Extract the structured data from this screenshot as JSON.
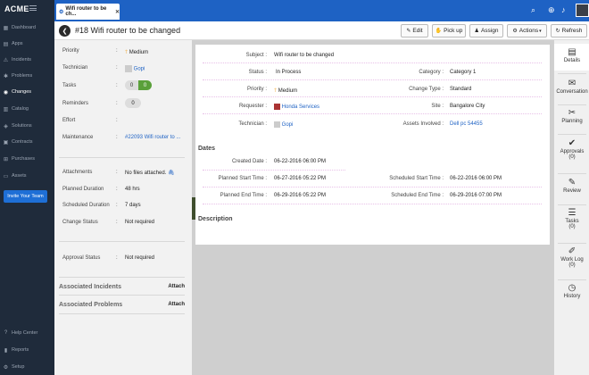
{
  "app": {
    "logo": "ACME"
  },
  "nav": {
    "items": [
      {
        "label": "Dashboard",
        "icon": "dashboard-icon",
        "glyph": "▦"
      },
      {
        "label": "Apps",
        "icon": "apps-icon",
        "glyph": "▤"
      },
      {
        "label": "Incidents",
        "icon": "incidents-icon",
        "glyph": "⚠"
      },
      {
        "label": "Problems",
        "icon": "problems-icon",
        "glyph": "✱"
      },
      {
        "label": "Changes",
        "icon": "changes-icon",
        "glyph": "◉"
      },
      {
        "label": "Catalog",
        "icon": "catalog-icon",
        "glyph": "▥"
      },
      {
        "label": "Solutions",
        "icon": "solutions-icon",
        "glyph": "◈"
      },
      {
        "label": "Contracts",
        "icon": "contracts-icon",
        "glyph": "▣"
      },
      {
        "label": "Purchases",
        "icon": "purchases-icon",
        "glyph": "⊞"
      },
      {
        "label": "Assets",
        "icon": "assets-icon",
        "glyph": "▭"
      }
    ],
    "invite": "Invite Your Team",
    "bottom": [
      {
        "label": "Help Center",
        "icon": "help-icon",
        "glyph": "?"
      },
      {
        "label": "Reports",
        "icon": "reports-icon",
        "glyph": "▮"
      },
      {
        "label": "Setup",
        "icon": "setup-icon",
        "glyph": "⚙"
      }
    ]
  },
  "tab": {
    "label": "Wifi router to be ch..."
  },
  "title": "#18 Wifi router to be changed",
  "toolbar": {
    "edit": "Edit",
    "pickup": "Pick up",
    "assign": "Assign",
    "actions": "Actions",
    "refresh": "Refresh"
  },
  "left_panel": {
    "priority_label": "Priority",
    "priority_value": "Medium",
    "technician_label": "Technician",
    "technician_value": "Gopi",
    "tasks_label": "Tasks",
    "tasks_a": "0",
    "tasks_b": "0",
    "reminders_label": "Reminders",
    "reminders_value": "0",
    "effort_label": "Effort",
    "maintenance_label": "Maintenance",
    "maintenance_value": "#22093 Wifi router to ...",
    "attachments_label": "Attachments",
    "attachments_value": "No files attached.",
    "planned_duration_label": "Planned Duration",
    "planned_duration_value": "48 hrs",
    "scheduled_duration_label": "Scheduled Duration",
    "scheduled_duration_value": "7 days",
    "change_status_label": "Change Status",
    "change_status_value": "Not required",
    "approval_status_label": "Approval Status",
    "approval_status_value": "Not required",
    "assoc_incidents": "Associated Incidents",
    "assoc_problems": "Associated Problems",
    "attach": "Attach"
  },
  "details": {
    "subject_label": "Subject :",
    "subject_value": "Wifi router to be changed",
    "status_label": "Status :",
    "status_value": "In Process",
    "category_label": "Category :",
    "category_value": "Category 1",
    "priority_label": "Priority :",
    "priority_value": "Medium",
    "change_type_label": "Change Type :",
    "change_type_value": "Standard",
    "requester_label": "Requester :",
    "requester_value": "Honda Services",
    "site_label": "Site :",
    "site_value": "Bangalore City",
    "technician_label": "Technician :",
    "technician_value": "Gopi",
    "assets_label": "Assets Involved :",
    "assets_value": "Dell pc 54455",
    "dates_heading": "Dates",
    "created_label": "Created Date :",
    "created_value": "06-22-2016 06:00 PM",
    "pstart_label": "Planned Start Time :",
    "pstart_value": "06-27-2016 05:22 PM",
    "sstart_label": "Scheduled Start Time :",
    "sstart_value": "06-22-2016 06:00 PM",
    "pend_label": "Planned End Time :",
    "pend_value": "06-29-2016 05:22 PM",
    "send_label": "Scheduled End Time :",
    "send_value": "06-29-2016 07:00 PM",
    "description_heading": "Description"
  },
  "right_bar": [
    {
      "label": "Details",
      "count": "",
      "glyph": "▤",
      "icon": "details-icon"
    },
    {
      "label": "Conversation",
      "count": "",
      "glyph": "✉",
      "icon": "conversation-icon"
    },
    {
      "label": "Planning",
      "count": "",
      "glyph": "✂",
      "icon": "planning-icon"
    },
    {
      "label": "Approvals",
      "count": "(0)",
      "glyph": "✔",
      "icon": "approvals-icon"
    },
    {
      "label": "Review",
      "count": "",
      "glyph": "✎",
      "icon": "review-icon"
    },
    {
      "label": "Tasks",
      "count": "(0)",
      "glyph": "☰",
      "icon": "tasks-icon"
    },
    {
      "label": "Work Log",
      "count": "(0)",
      "glyph": "✐",
      "icon": "worklog-icon"
    },
    {
      "label": "History",
      "count": "",
      "glyph": "◷",
      "icon": "history-icon"
    }
  ],
  "colors": {
    "brand": "#1e62c4",
    "nav_bg": "#1f2b3b",
    "accent_green": "#5aa03a"
  }
}
